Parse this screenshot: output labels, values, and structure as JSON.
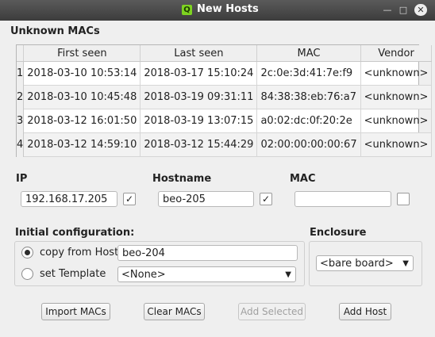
{
  "window": {
    "title": "New Hosts",
    "app_icon_letter": "Q"
  },
  "unknown_macs": {
    "heading": "Unknown MACs",
    "columns": [
      "First seen",
      "Last seen",
      "MAC",
      "Vendor"
    ],
    "rows": [
      {
        "num": "1",
        "first": "2018-03-10 10:53:14",
        "last": "2018-03-17 15:10:24",
        "mac": "2c:0e:3d:41:7e:f9",
        "vendor": "<unknown>"
      },
      {
        "num": "2",
        "first": "2018-03-10 10:45:48",
        "last": "2018-03-19 09:31:11",
        "mac": "84:38:38:eb:76:a7",
        "vendor": "<unknown>"
      },
      {
        "num": "3",
        "first": "2018-03-12 16:01:50",
        "last": "2018-03-19 13:07:15",
        "mac": "a0:02:dc:0f:20:2e",
        "vendor": "<unknown>"
      },
      {
        "num": "4",
        "first": "2018-03-12 14:59:10",
        "last": "2018-03-12 15:44:29",
        "mac": "02:00:00:00:00:67",
        "vendor": "<unknown>"
      }
    ]
  },
  "ip": {
    "label": "IP",
    "value": "192.168.17.205",
    "checked": "✓"
  },
  "hostname": {
    "label": "Hostname",
    "value": "beo-205",
    "checked": "✓"
  },
  "mac": {
    "label": "MAC",
    "value": ""
  },
  "initial_config": {
    "heading": "Initial configuration:",
    "copy_label": "copy from Host",
    "copy_value": "beo-204",
    "template_label": "set Template",
    "template_value": "<None>"
  },
  "enclosure": {
    "heading": "Enclosure",
    "value": "<bare board>"
  },
  "buttons": {
    "import": "Import MACs",
    "clear": "Clear MACs",
    "add_selected": "Add Selected",
    "add_host": "Add Host"
  }
}
